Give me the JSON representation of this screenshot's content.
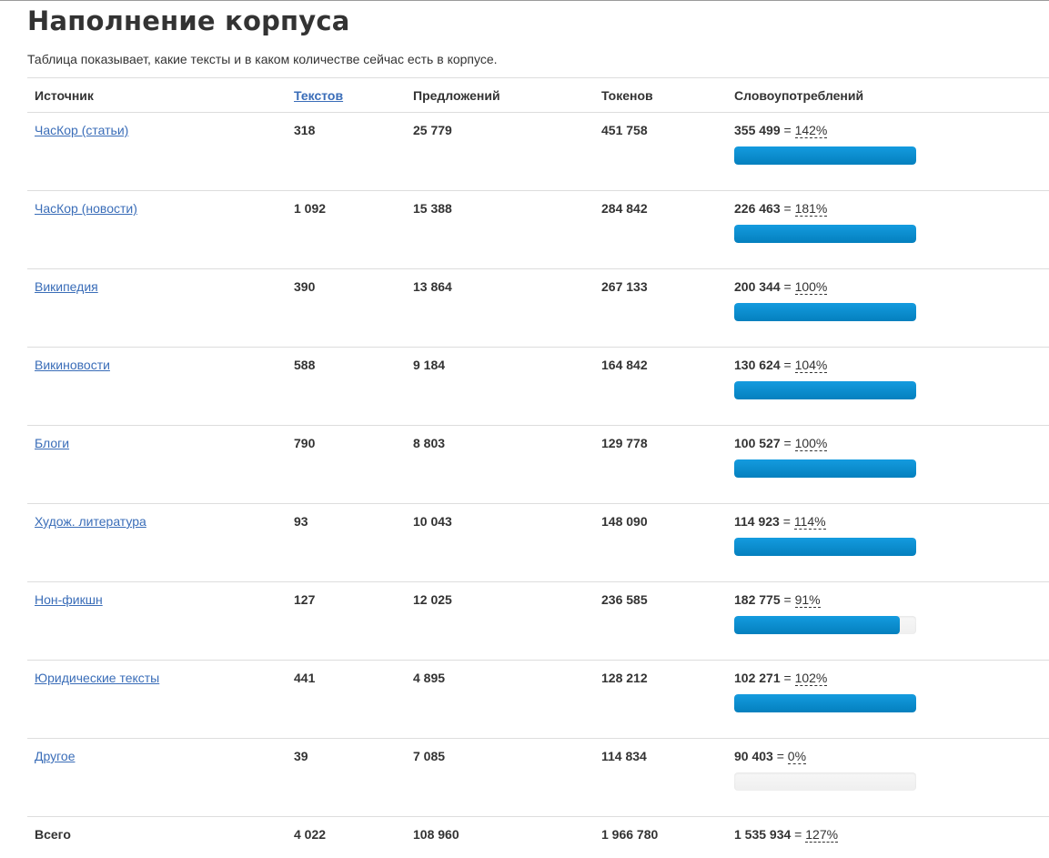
{
  "page": {
    "title": "Наполнение корпуса",
    "description": "Таблица показывает, какие тексты и в каком количестве сейчас есть в корпусе."
  },
  "table": {
    "headers": {
      "source": "Источник",
      "texts": "Текстов",
      "sentences": "Предложений",
      "tokens": "Токенов",
      "usages": "Словоупотреблений"
    },
    "rows": [
      {
        "source": "ЧасКор (статьи)",
        "texts": "318",
        "sentences": "25 779",
        "tokens": "451 758",
        "usages": "355 499",
        "pct_label": "142%",
        "bar_fill": 1.0
      },
      {
        "source": "ЧасКор (новости)",
        "texts": "1 092",
        "sentences": "15 388",
        "tokens": "284 842",
        "usages": "226 463",
        "pct_label": "181%",
        "bar_fill": 1.0
      },
      {
        "source": "Википедия",
        "texts": "390",
        "sentences": "13 864",
        "tokens": "267 133",
        "usages": "200 344",
        "pct_label": "100%",
        "bar_fill": 1.0
      },
      {
        "source": "Викиновости",
        "texts": "588",
        "sentences": "9 184",
        "tokens": "164 842",
        "usages": "130 624",
        "pct_label": "104%",
        "bar_fill": 1.0
      },
      {
        "source": "Блоги",
        "texts": "790",
        "sentences": "8 803",
        "tokens": "129 778",
        "usages": "100 527",
        "pct_label": "100%",
        "bar_fill": 1.0
      },
      {
        "source": "Худож. литература",
        "texts": "93",
        "sentences": "10 043",
        "tokens": "148 090",
        "usages": "114 923",
        "pct_label": "114%",
        "bar_fill": 1.0
      },
      {
        "source": "Нон-фикшн",
        "texts": "127",
        "sentences": "12 025",
        "tokens": "236 585",
        "usages": "182 775",
        "pct_label": "91%",
        "bar_fill": 0.91
      },
      {
        "source": "Юридические тексты",
        "texts": "441",
        "sentences": "4 895",
        "tokens": "128 212",
        "usages": "102 271",
        "pct_label": "102%",
        "bar_fill": 1.0
      },
      {
        "source": "Другое",
        "texts": "39",
        "sentences": "7 085",
        "tokens": "114 834",
        "usages": "90 403",
        "pct_label": "0%",
        "bar_fill": 0.0
      }
    ],
    "total": {
      "label": "Всего",
      "texts": "4 022",
      "sentences": "108 960",
      "tokens": "1 966 780",
      "usages": "1 535 934",
      "pct_label": "127%"
    }
  },
  "colors": {
    "link": "#3a6db8",
    "bar_fill": "#0e90d2",
    "bar_track": "#f5f5f5",
    "divider": "#dddddd"
  }
}
